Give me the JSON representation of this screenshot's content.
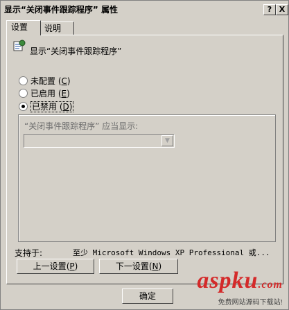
{
  "window": {
    "title": "显示“关闭事件跟踪程序” 属性",
    "help_button": "?",
    "close_button": "X"
  },
  "tabs": [
    {
      "label": "设置",
      "active": true
    },
    {
      "label": "说明",
      "active": false
    }
  ],
  "policy": {
    "icon": "policy-settings-icon",
    "name": "显示“关闭事件跟踪程序”"
  },
  "options": [
    {
      "label": "未配置",
      "hotkey": "C",
      "checked": false
    },
    {
      "label": "已启用",
      "hotkey": "E",
      "checked": false
    },
    {
      "label": "已禁用",
      "hotkey": "D",
      "checked": true
    }
  ],
  "group": {
    "label": "“关闭事件跟踪程序” 应当显示:",
    "select_value": ""
  },
  "supported": {
    "label": "支持于:",
    "text": "至少 Microsoft Windows XP Professional 或..."
  },
  "buttons": {
    "prev_label": "上一设置",
    "prev_hotkey": "P",
    "next_label": "下一设置",
    "next_hotkey": "N",
    "ok_label": "确定"
  },
  "watermark": {
    "brand": "aspku",
    "cn": ".com",
    "tagline": "免费网站源码下载站!"
  }
}
